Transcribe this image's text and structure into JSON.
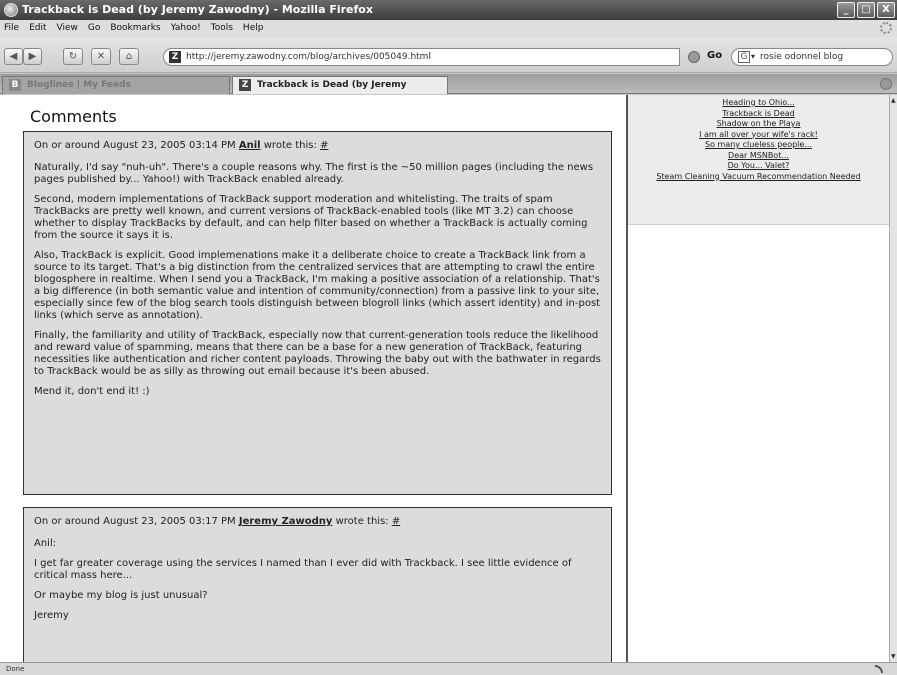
{
  "window": {
    "title": "Trackback is Dead (by Jeremy Zawodny) - Mozilla Firefox",
    "buttons": {
      "minimize": "_",
      "maximize": "□",
      "close": "X"
    }
  },
  "menu": [
    "File",
    "Edit",
    "View",
    "Go",
    "Bookmarks",
    "Yahoo!",
    "Tools",
    "Help"
  ],
  "nav": {
    "back": "◀",
    "forward": "▶",
    "reload": "↻",
    "stop": "✕",
    "home": "⌂",
    "site_icon": "Z",
    "url": "http://jeremy.zawodny.com/blog/archives/005049.html",
    "go_label": "Go",
    "search_icon": "G",
    "search_dropdown": "▾",
    "search_value": "rosie odonnel blog"
  },
  "tabs": [
    {
      "icon": "B",
      "label": "Bloglines | My Feeds"
    },
    {
      "icon": "Z",
      "label": "Trackback is Dead (by Jeremy Zawod..."
    }
  ],
  "page": {
    "heading": "Comments",
    "comments": [
      {
        "meta_prefix": "On or around August 23, 2005 03:14 PM ",
        "author": "Anil",
        "meta_suffix": " wrote this: ",
        "permalink": "#",
        "paragraphs": [
          "Naturally, I'd say \"nuh-uh\". There's a couple reasons why. The first is the ~50 million pages (including the news pages published by... Yahoo!) with TrackBack enabled already.",
          "Second, modern implementations of TrackBack support moderation and whitelisting. The traits of spam TrackBacks are pretty well known, and current versions of TrackBack-enabled tools (like MT 3.2) can choose whether to display TrackBacks by default, and can help filter based on whether a TrackBack is actually coming from the source it says it is.",
          "Also, TrackBack is explicit. Good implemenations make it a deliberate choice to create a TrackBack link from a source to its target. That's a big distinction from the centralized services that are attempting to crawl the entire blogosphere in realtime. When I send you a TrackBack, I'm making a positive association of a relationship. That's a big difference (in both semantic value and intention of community/connection) from a passive link to your site, especially since few of the blog search tools distinguish between blogroll links (which assert identity) and in-post links (which serve as annotation).",
          "Finally, the familiarity and utility of TrackBack, especially now that current-generation tools reduce the likelihood and reward value of spamming, means that there can be a base for a new generation of TrackBack, featuring necessities like authentication and richer content payloads. Throwing the baby out with the bathwater in regards to TrackBack would be as silly as throwing out email because it's been abused.",
          "Mend it, don't end it! :)"
        ]
      },
      {
        "meta_prefix": "On or around August 23, 2005 03:17 PM ",
        "author": "Jeremy Zawodny",
        "meta_suffix": " wrote this: ",
        "permalink": "#",
        "paragraphs": [
          "Anil:",
          "I get far greater coverage using the services I named than I ever did with Trackback. I see little evidence of critical mass here...",
          "Or maybe my blog is just unusual?",
          "Jeremy"
        ]
      }
    ]
  },
  "sidebar": {
    "links": [
      "Heading to Ohio...",
      "Trackback is Dead",
      "Shadow on the Playa",
      "I am all over your wife's rack!",
      "So many clueless people...",
      "Dear MSNBot...",
      "Do You... Valet?",
      "Steam Cleaning Vacuum Recommendation Needed"
    ]
  },
  "status": {
    "text": "Done"
  },
  "colors": {
    "titlebar": "#4a4a4a",
    "comment_bg": "#dcdcdc",
    "sidebar_bg": "#ececec"
  }
}
